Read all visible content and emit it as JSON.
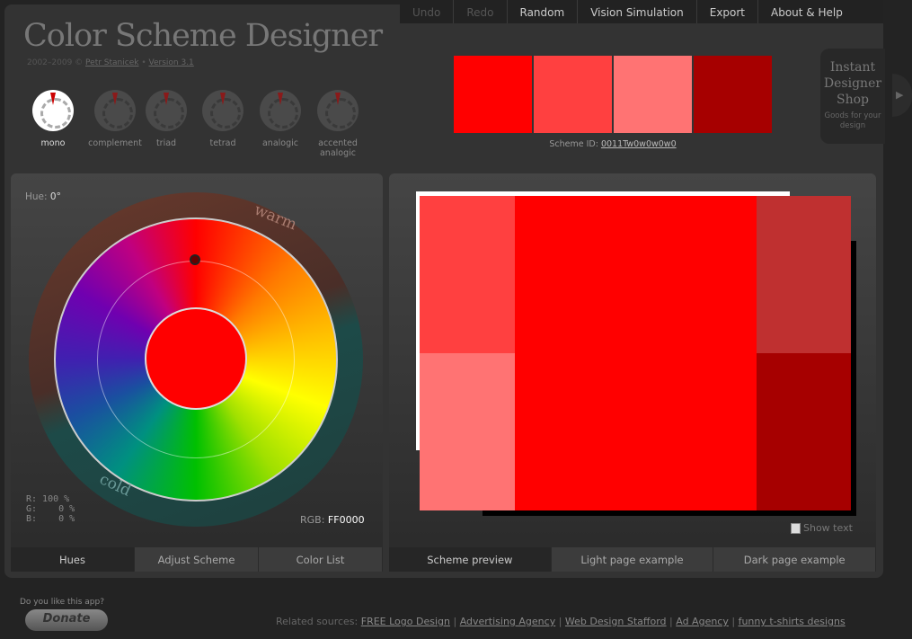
{
  "nav": {
    "items": [
      {
        "label": "Undo",
        "disabled": true
      },
      {
        "label": "Redo",
        "disabled": true
      },
      {
        "label": "Random"
      },
      {
        "label": "Vision Simulation"
      },
      {
        "label": "Export"
      },
      {
        "label": "About & Help"
      }
    ]
  },
  "header": {
    "title": "Color Scheme Designer",
    "years": "2002–2009 ©",
    "author": "Petr Stanicek",
    "sep": "•",
    "version": "Version 3.1"
  },
  "schemes": [
    {
      "label": "mono",
      "active": true
    },
    {
      "label": "complement"
    },
    {
      "label": "triad"
    },
    {
      "label": "tetrad"
    },
    {
      "label": "analogic"
    },
    {
      "label": "accented analogic"
    }
  ],
  "swatches": [
    "#FF0000",
    "#FF4040",
    "#FF7373",
    "#A60000"
  ],
  "scheme_id": {
    "label": "Scheme ID:",
    "value": "0011Tw0w0w0w0"
  },
  "shop": {
    "title": "Instant Designer Shop",
    "sub": "Goods for your design"
  },
  "wheel": {
    "hue_label": "Hue:",
    "hue": "0°",
    "warm": "warm",
    "cold": "cold",
    "rgb_percent": "R: 100 %\nG:    0 %\nB:    0 %",
    "rgb_label": "RGB:",
    "rgb": "FF0000"
  },
  "left_tabs": [
    "Hues",
    "Adjust Scheme",
    "Color List"
  ],
  "preview": {
    "colors": {
      "main": "#FF0000",
      "tl": "#FF4040",
      "bl": "#FF7373",
      "tr": "#BF3030",
      "br": "#A60000"
    },
    "show_text": "Show text"
  },
  "right_tabs": [
    "Scheme preview",
    "Light page example",
    "Dark page example"
  ],
  "footer": {
    "question": "Do you like this app?",
    "donate": "Donate",
    "related_label": "Related sources:",
    "links": [
      "FREE Logo Design",
      "Advertising Agency",
      "Web Design Stafford",
      "Ad Agency",
      "funny t-shirts designs"
    ]
  }
}
